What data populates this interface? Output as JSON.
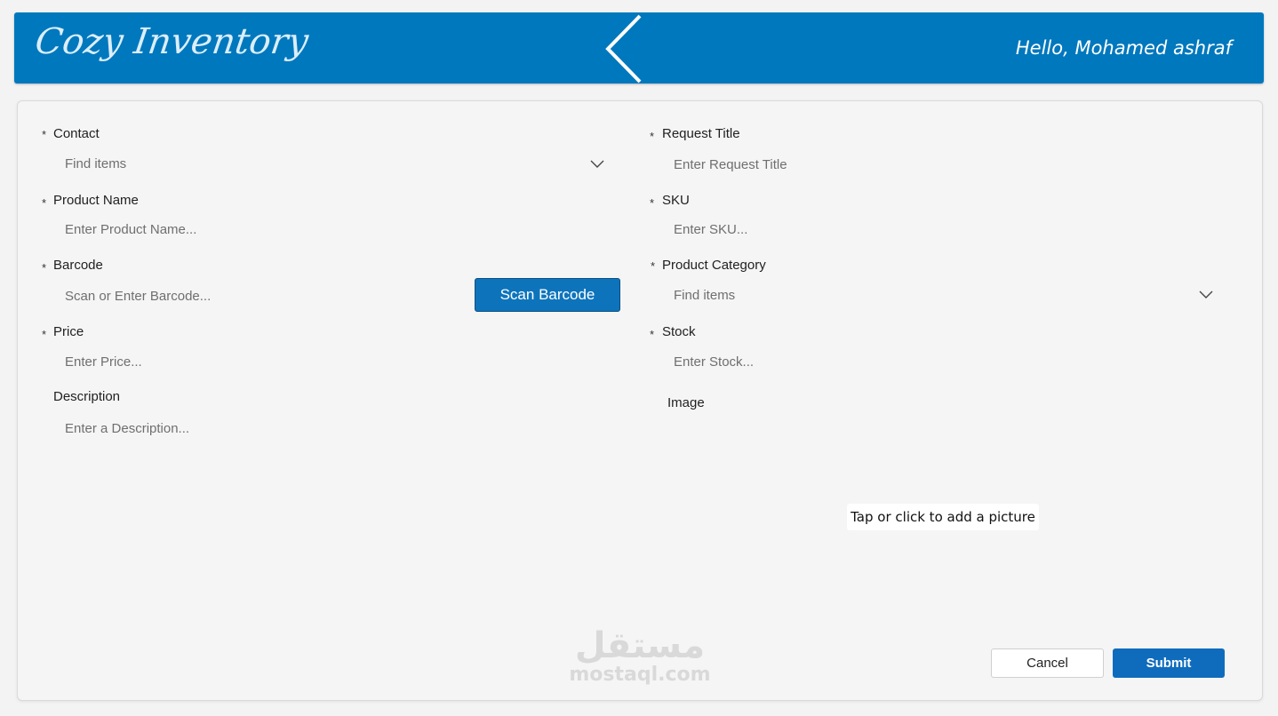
{
  "header": {
    "logo_text": "Cozy Inventory",
    "greeting": "Hello, Mohamed ashraf",
    "background_color": "#0078bd"
  },
  "form": {
    "contact": {
      "label": "Contact",
      "required_mark": "*",
      "placeholder": "Find items"
    },
    "product_name": {
      "label": "Product Name",
      "required_mark": "*",
      "placeholder": "Enter Product Name..."
    },
    "barcode": {
      "label": "Barcode",
      "required_mark": "*",
      "placeholder": "Scan or Enter Barcode...",
      "scan_button": "Scan Barcode"
    },
    "price": {
      "label": "Price",
      "required_mark": "*",
      "placeholder": "Enter Price..."
    },
    "description": {
      "label": "Description",
      "placeholder": "Enter a Description..."
    },
    "request_title": {
      "label": "Request Title",
      "required_mark": "*",
      "placeholder": "Enter Request Title"
    },
    "sku": {
      "label": "SKU",
      "required_mark": "*",
      "placeholder": "Enter SKU..."
    },
    "product_category": {
      "label": "Product Category",
      "required_mark": "*",
      "placeholder": "Find items"
    },
    "stock": {
      "label": "Stock",
      "required_mark": "*",
      "placeholder": "Enter Stock..."
    },
    "image": {
      "label": "Image",
      "add_picture": "Tap or click to add a picture"
    }
  },
  "actions": {
    "cancel": "Cancel",
    "submit": "Submit",
    "primary_color": "#0f6cbd"
  },
  "watermark": {
    "arabic": "مستقل",
    "latin": "mostaql.com"
  }
}
